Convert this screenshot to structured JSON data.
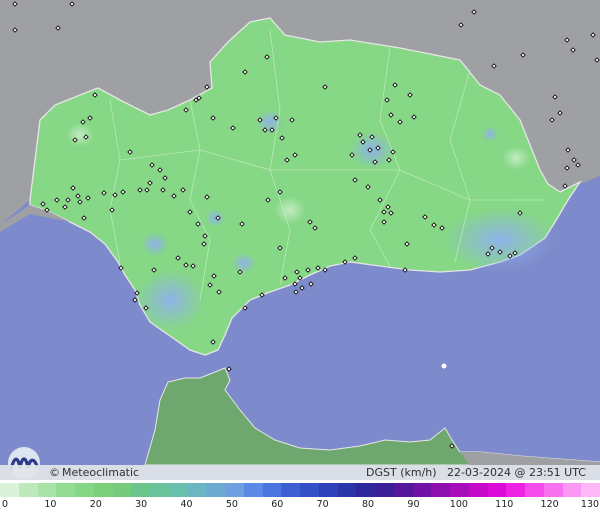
{
  "caption": {
    "brand_symbol": "©",
    "brand": "Meteoclimatic",
    "variable": "DGST (km/h)",
    "date": "22-03-2024",
    "at": "@",
    "time": "23:51 UTC"
  },
  "logo": {
    "icon": "meteoclimatic-logo-icon"
  },
  "colors": {
    "sea": "#7d8acb",
    "land_outside": "#9fa0a4",
    "region": "#86d786",
    "morocco": "#6fa86f",
    "border": "#e6e6e6",
    "station": "#111111"
  },
  "scale": {
    "ticks": [
      "0",
      "10",
      "20",
      "30",
      "40",
      "50",
      "60",
      "70",
      "80",
      "90",
      "100",
      "110",
      "120",
      "130"
    ],
    "colors": [
      "#d9f2d9",
      "#bdeabd",
      "#a8e4a8",
      "#94dc94",
      "#85d685",
      "#7cd07c",
      "#74cb7e",
      "#6cc58a",
      "#68c29a",
      "#66c0ab",
      "#6ab7c2",
      "#6daad2",
      "#6f9fe0",
      "#5a8ae6",
      "#4a74de",
      "#3d5fd2",
      "#3550c6",
      "#2d42b8",
      "#2a35a8",
      "#2f289c",
      "#3c1f96",
      "#56189a",
      "#7012a3",
      "#8c0fae",
      "#a80cbb",
      "#c40ac8",
      "#dc0ad6",
      "#ee22e2",
      "#f44cea",
      "#f872f0",
      "#fb98f4",
      "#feb8f8"
    ]
  }
}
